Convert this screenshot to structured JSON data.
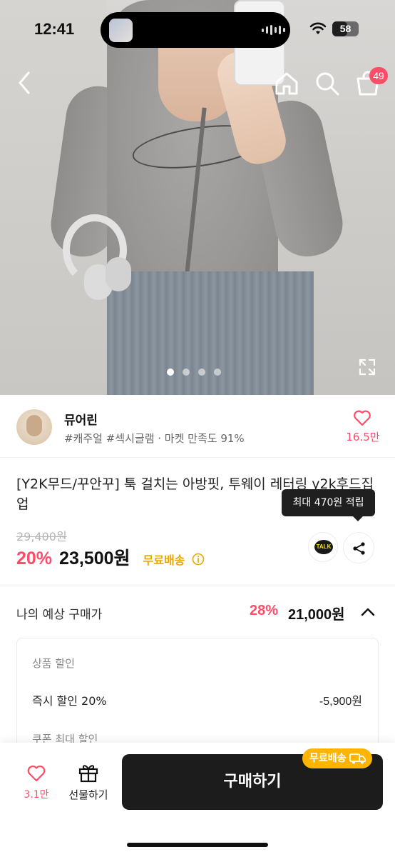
{
  "status_bar": {
    "time": "12:41",
    "battery": "58"
  },
  "nav": {
    "cart_count": "49"
  },
  "carousel": {
    "total": 4,
    "active_index": 0
  },
  "seller": {
    "name": "뮤어린",
    "tags": "#캐주얼 #섹시글램 · 마켓 만족도 91%",
    "likes": "16.5만"
  },
  "product": {
    "title": "[Y2K무드/꾸안꾸] 툭 걸치는 아방핏, 투웨이 레터링 y2k후드집업",
    "points_tooltip": "최대 470원 적립",
    "original_price": "29,400원",
    "discount_rate": "20%",
    "price": "23,500원",
    "free_shipping": "무료배송",
    "kakao_label": "TALK"
  },
  "expected_price": {
    "label": "나의 예상 구매가",
    "rate": "28%",
    "amount": "21,000원",
    "product_discount_label": "상품 할인",
    "instant_discount_label": "즉시 할인 20%",
    "instant_discount_value": "-5,900원",
    "coupon_label": "쿠폰 최대 할인"
  },
  "bottom_bar": {
    "like_count": "3.1만",
    "gift_label": "선물하기",
    "buy_label": "구매하기",
    "ship_badge": "무료배송"
  },
  "colors": {
    "accent": "#ff4c68",
    "shipping": "#e9a800",
    "buy_button": "#1c1c1c"
  }
}
